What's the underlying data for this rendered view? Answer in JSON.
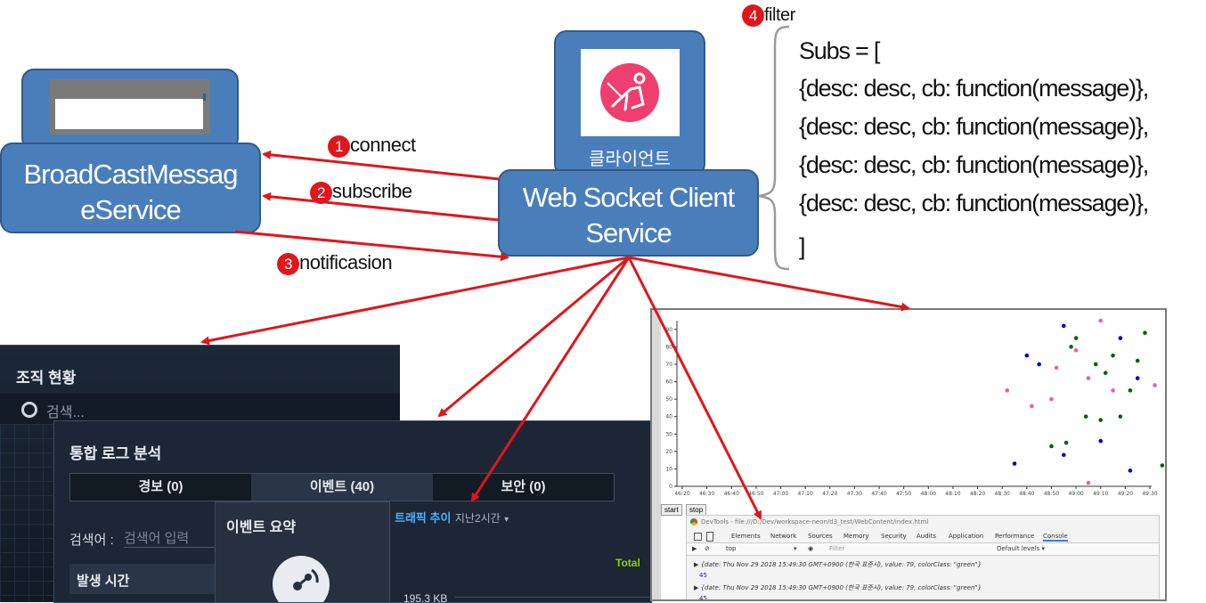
{
  "services": {
    "broadcast": {
      "label_line1": "BroadCastMessag",
      "label_line2": "eService"
    },
    "ws_client": {
      "label_line1": "Web Socket Client",
      "label_line2": "Service",
      "icon_caption": "클라이언트"
    }
  },
  "steps": [
    {
      "num": "1",
      "label": "connect"
    },
    {
      "num": "2",
      "label": "subscribe"
    },
    {
      "num": "3",
      "label": "notificasion"
    },
    {
      "num": "4",
      "label": "filter"
    }
  ],
  "subs_code": {
    "open": "Subs = [",
    "lines": [
      "{desc: desc, cb: function(message)},",
      "{desc: desc, cb: function(message)},",
      "{desc: desc, cb: function(message)},",
      "{desc: desc, cb: function(message)},"
    ],
    "close": "]"
  },
  "org_panel": {
    "title": "조직 현황",
    "search_placeholder": "검색..."
  },
  "log_panel": {
    "title": "통합 로그 분석",
    "tabs": [
      "경보 (0)",
      "이벤트 (40)",
      "보안 (0)"
    ],
    "search_label": "검색어 :",
    "search_placeholder": "검색어 입력",
    "column_header": "발생 시간",
    "event_summary_title": "이벤트 요약",
    "traffic_title": "트래픽 추이",
    "traffic_range": "지난2시간",
    "total_label": "Total",
    "traffic_value": "195.3 KB"
  },
  "chart_buttons": {
    "start": "start",
    "stop": "stop"
  },
  "chart_data": {
    "type": "scatter",
    "x_ticks": [
      "46:20",
      "46:30",
      "46:40",
      "46:50",
      "47:00",
      "47:10",
      "47:20",
      "47:30",
      "47:40",
      "47:50",
      "48:00",
      "48:10",
      "48:20",
      "48:30",
      "48:40",
      "48:50",
      "49:00",
      "49:10",
      "49:20",
      "49:30"
    ],
    "y_ticks": [
      "0",
      "10",
      "20",
      "30",
      "40",
      "50",
      "60",
      "70",
      "80",
      "90"
    ],
    "ylim": [
      0,
      95
    ],
    "xlim_seconds": [
      3975,
      3037
    ],
    "series": [
      {
        "color": "#006400",
        "points": [
          [
            2940,
            85
          ],
          [
            2948,
            70
          ],
          [
            2955,
            75
          ],
          [
            2965,
            72
          ],
          [
            2978,
            80
          ],
          [
            2990,
            78
          ],
          [
            2985,
            68
          ],
          [
            2952,
            65
          ],
          [
            2944,
            40
          ],
          [
            2950,
            38
          ],
          [
            2958,
            40
          ],
          [
            2930,
            23
          ],
          [
            2936,
            25
          ],
          [
            2962,
            55
          ],
          [
            3000,
            57
          ],
          [
            3018,
            27
          ],
          [
            3020,
            10
          ],
          [
            2975,
            12
          ],
          [
            2938,
            80
          ],
          [
            2968,
            88
          ]
        ]
      },
      {
        "color": "#0000cd",
        "points": [
          [
            2935,
            92
          ],
          [
            2958,
            85
          ],
          [
            3010,
            88
          ],
          [
            2925,
            70
          ],
          [
            2965,
            62
          ],
          [
            2980,
            60
          ],
          [
            3022,
            62
          ],
          [
            3028,
            58
          ],
          [
            3012,
            48
          ],
          [
            2990,
            46
          ],
          [
            3005,
            32
          ],
          [
            3016,
            30
          ],
          [
            2950,
            26
          ],
          [
            2935,
            18
          ],
          [
            2915,
            13
          ],
          [
            2962,
            9
          ],
          [
            2993,
            15
          ],
          [
            3032,
            64
          ],
          [
            2920,
            75
          ]
        ]
      },
      {
        "color": "#ee5fa7",
        "points": [
          [
            2950,
            95
          ],
          [
            2940,
            78
          ],
          [
            2990,
            70
          ],
          [
            3008,
            44
          ],
          [
            2945,
            62
          ],
          [
            2932,
            68
          ],
          [
            2955,
            55
          ],
          [
            2912,
            55
          ],
          [
            2922,
            46
          ],
          [
            3020,
            38
          ],
          [
            3010,
            30
          ],
          [
            2990,
            20
          ],
          [
            2945,
            2
          ],
          [
            3024,
            35
          ],
          [
            2972,
            58
          ],
          [
            2930,
            50
          ]
        ]
      }
    ]
  },
  "devtools": {
    "title": "DevTools - file:///D:/Dev/workspace-neon/d3_test/WebContent/index.html",
    "tabs": [
      "Elements",
      "Network",
      "Sources",
      "Memory",
      "Security",
      "Audits",
      "Application",
      "Performance",
      "Console"
    ],
    "context": "top",
    "filter_placeholder": "Filter",
    "levels": "Default levels ▾",
    "log_lines": [
      "▶ {date: Thu Nov 29 2018 15:49:30 GMT+0900 (한국 표준시), value: 79, colorClass: \"green\"}",
      "45",
      "▶ {date: Thu Nov 29 2018 15:49:30 GMT+0900 (한국 표준시), value: 79, colorClass: \"green\"}",
      "45"
    ]
  },
  "colors": {
    "service_fill": "#4a7ebb",
    "arrow": "#e0161b",
    "panel_dark": "#1b2634",
    "panel_text": "#e6e9ee",
    "traffic_title": "#4fb3ff",
    "total": "#8fd400"
  }
}
